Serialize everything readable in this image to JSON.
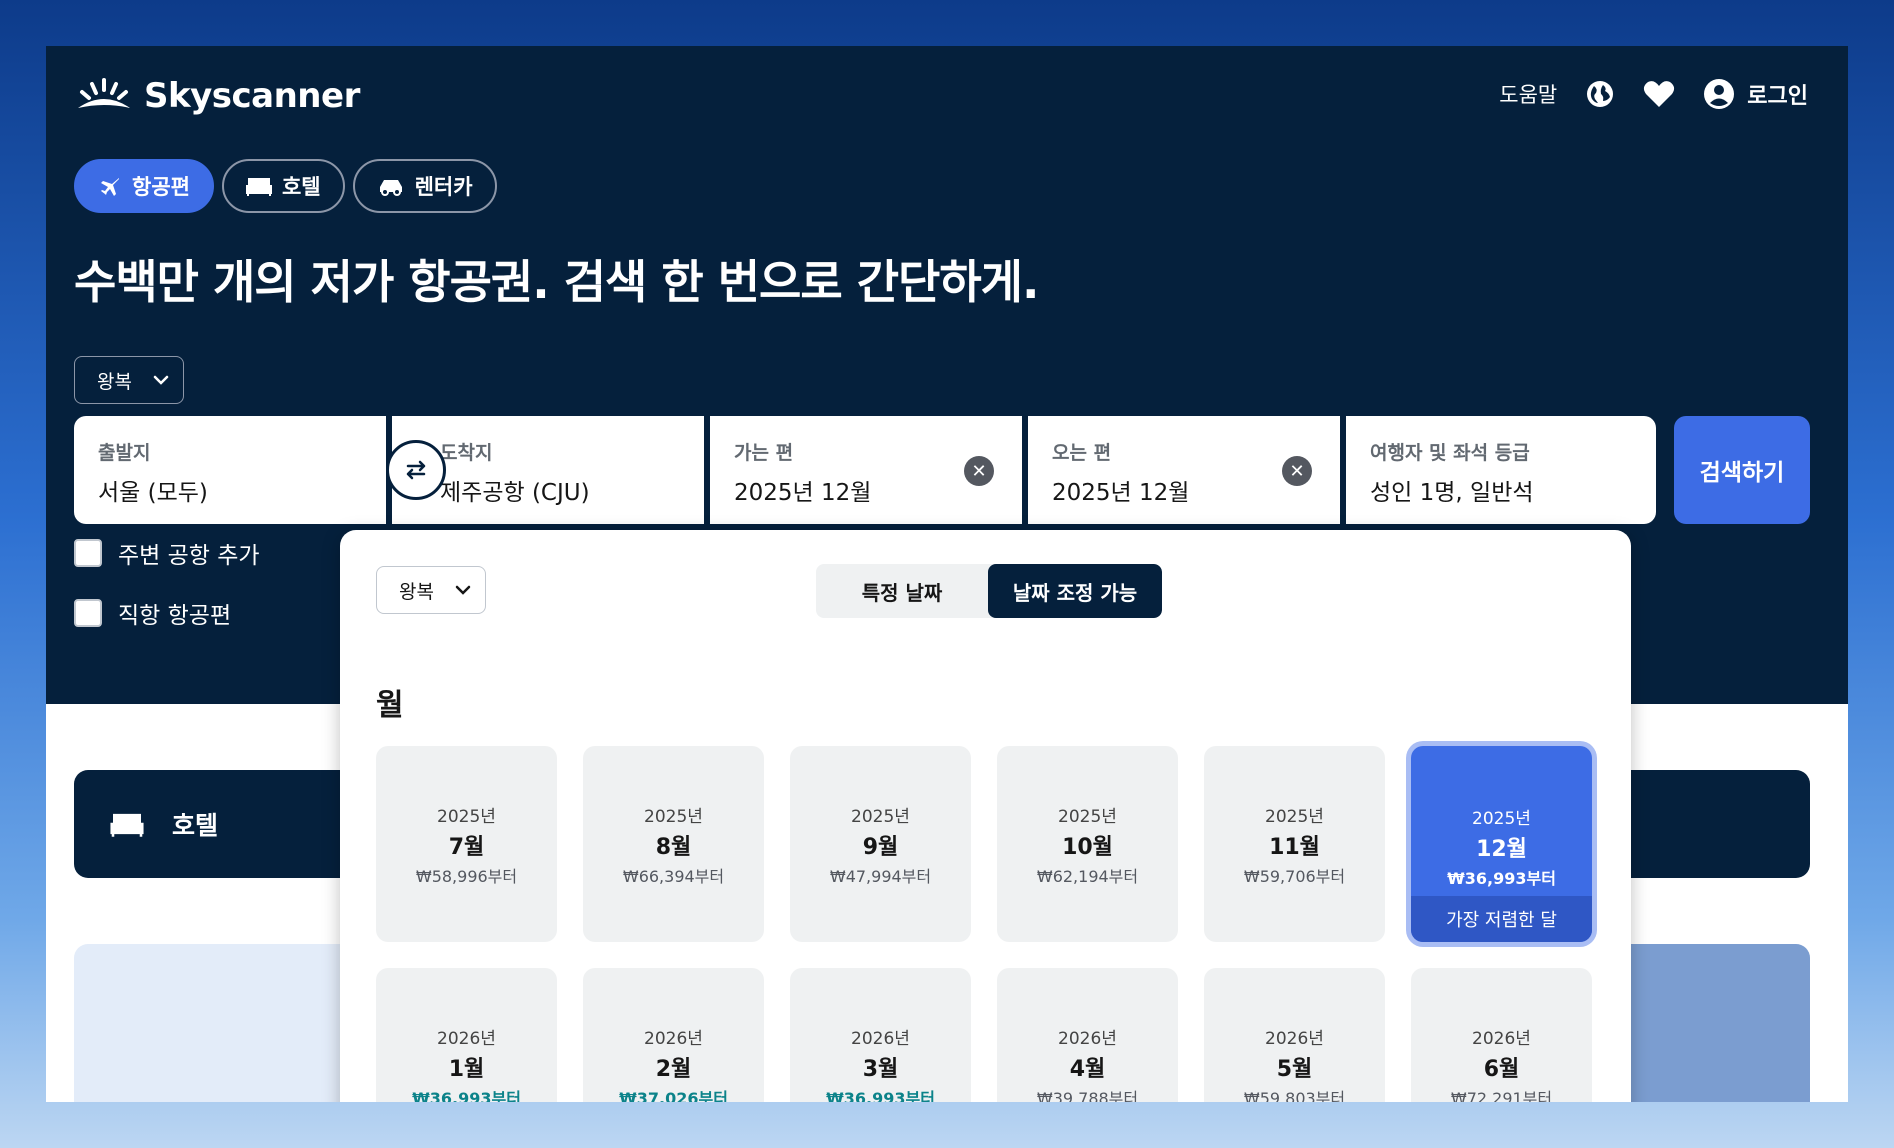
{
  "brand": {
    "name": "Skyscanner"
  },
  "nav": {
    "help": "도움말",
    "login": "로그인"
  },
  "tabs": [
    {
      "label": "항공편",
      "icon": "plane-icon",
      "active": true
    },
    {
      "label": "호텔",
      "icon": "bed-icon",
      "active": false
    },
    {
      "label": "렌터카",
      "icon": "car-icon",
      "active": false
    }
  ],
  "headline": "수백만 개의 저가 항공권. 검색 한 번으로 간단하게.",
  "trip_type": "왕복",
  "search": {
    "origin": {
      "label": "출발지",
      "value": "서울 (모두)"
    },
    "destination": {
      "label": "도착지",
      "value": "제주공항 (CJU)"
    },
    "depart": {
      "label": "가는 편",
      "value": "2025년 12월"
    },
    "return": {
      "label": "오는 편",
      "value": "2025년 12월"
    },
    "travellers": {
      "label": "여행자 및 좌석 등급",
      "value": "성인 1명, 일반석"
    },
    "button": "검색하기"
  },
  "options": {
    "nearby": "주변 공항 추가",
    "direct": "직항 항공편"
  },
  "hotel_bar": {
    "label": "호텔"
  },
  "picker": {
    "trip_type": "왕복",
    "toggle": {
      "specific": "특정 날짜",
      "flexible": "날짜 조정 가능"
    },
    "section_title": "월",
    "cheapest_label": "가장 저렴한 달",
    "months": [
      {
        "year": "2025년",
        "month": "7월",
        "price": "₩58,996부터",
        "highlight": false,
        "selected": false
      },
      {
        "year": "2025년",
        "month": "8월",
        "price": "₩66,394부터",
        "highlight": false,
        "selected": false
      },
      {
        "year": "2025년",
        "month": "9월",
        "price": "₩47,994부터",
        "highlight": false,
        "selected": false
      },
      {
        "year": "2025년",
        "month": "10월",
        "price": "₩62,194부터",
        "highlight": false,
        "selected": false
      },
      {
        "year": "2025년",
        "month": "11월",
        "price": "₩59,706부터",
        "highlight": false,
        "selected": false
      },
      {
        "year": "2025년",
        "month": "12월",
        "price": "₩36,993부터",
        "highlight": false,
        "selected": true
      },
      {
        "year": "2026년",
        "month": "1월",
        "price": "₩36,993부터",
        "highlight": true,
        "selected": false
      },
      {
        "year": "2026년",
        "month": "2월",
        "price": "₩37,026부터",
        "highlight": true,
        "selected": false
      },
      {
        "year": "2026년",
        "month": "3월",
        "price": "₩36,993부터",
        "highlight": true,
        "selected": false
      },
      {
        "year": "2026년",
        "month": "4월",
        "price": "₩39,788부터",
        "highlight": false,
        "selected": false
      },
      {
        "year": "2026년",
        "month": "5월",
        "price": "₩59,803부터",
        "highlight": false,
        "selected": false
      },
      {
        "year": "2026년",
        "month": "6월",
        "price": "₩72,291부터",
        "highlight": false,
        "selected": false
      }
    ]
  },
  "colors": {
    "navy": "#05203c",
    "accent": "#3d6ce5",
    "green_price": "#0c838a"
  }
}
